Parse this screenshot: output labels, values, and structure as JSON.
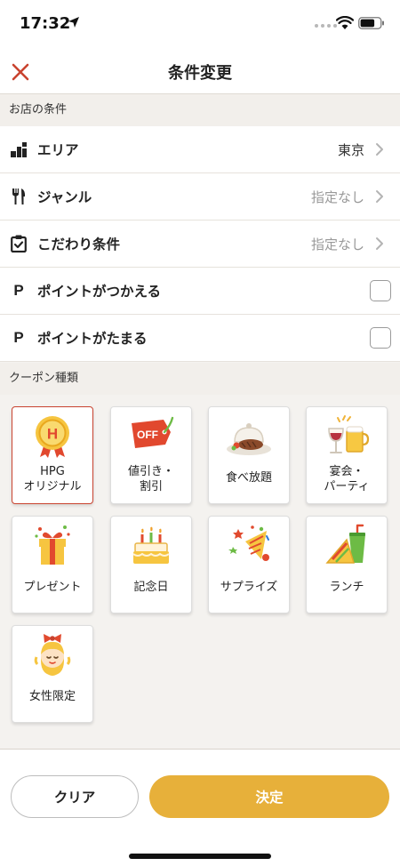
{
  "status": {
    "time": "17:32"
  },
  "nav": {
    "title": "条件変更",
    "close_icon": "close-x-icon"
  },
  "store_section": {
    "header": "お店の条件",
    "rows": [
      {
        "label": "エリア",
        "value": "東京",
        "icon": "area-icon"
      },
      {
        "label": "ジャンル",
        "value": "指定なし",
        "icon": "fork-knife-icon"
      },
      {
        "label": "こだわり条件",
        "value": "指定なし",
        "icon": "clipboard-check-icon"
      },
      {
        "label": "ポイントがつかえる",
        "icon_text": "P",
        "checked": false
      },
      {
        "label": "ポイントがたまる",
        "icon_text": "P",
        "checked": false
      }
    ]
  },
  "coupon_section": {
    "header": "クーポン種類",
    "items": [
      {
        "label": "HPG\nオリジナル",
        "icon": "hpg-medal-icon",
        "medal_letter": "H",
        "selected": true
      },
      {
        "label": "値引き・\n割引",
        "icon": "off-tag-icon",
        "tag_text": "OFF",
        "selected": false
      },
      {
        "label": "食べ放題",
        "icon": "buffet-dome-icon",
        "selected": false
      },
      {
        "label": "宴会・\nパーティ",
        "icon": "toast-glasses-icon",
        "selected": false
      },
      {
        "label": "プレゼント",
        "icon": "gift-icon",
        "selected": false
      },
      {
        "label": "記念日",
        "icon": "cake-icon",
        "selected": false
      },
      {
        "label": "サプライズ",
        "icon": "party-popper-icon",
        "selected": false
      },
      {
        "label": "ランチ",
        "icon": "sandwich-drink-icon",
        "selected": false
      },
      {
        "label": "女性限定",
        "icon": "woman-face-icon",
        "selected": false
      }
    ]
  },
  "buttons": {
    "clear": "クリア",
    "decide": "決定"
  },
  "colors": {
    "accent": "#e7b03a",
    "close": "#c9432f",
    "selected_border": "#c9432f"
  }
}
